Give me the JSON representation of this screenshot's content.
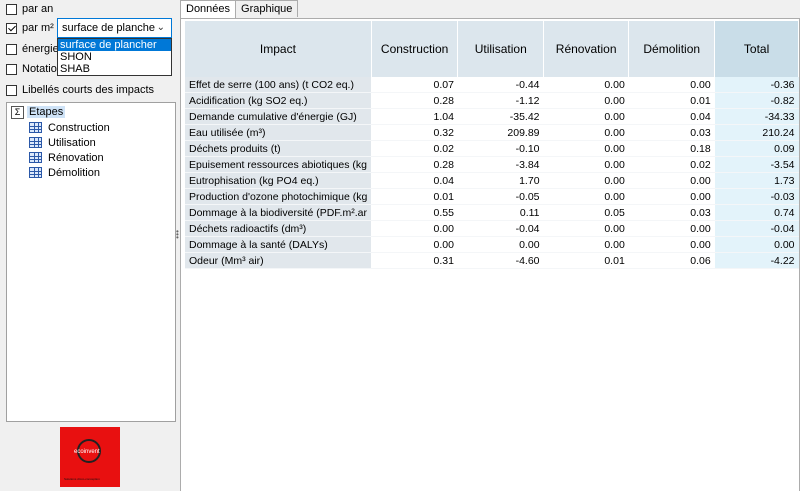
{
  "options": {
    "par_an": {
      "label": "par an",
      "checked": false
    },
    "par_m2": {
      "label": "par m²",
      "checked": true
    },
    "energie": {
      "label": "énergie",
      "checked": false
    },
    "notation": {
      "label": "Notatio",
      "checked": false
    },
    "libelles": {
      "label": "Libellés courts des impacts",
      "checked": false
    }
  },
  "unit_select": {
    "value": "surface de planche",
    "options": [
      "surface de plancher",
      "SHON",
      "SHAB"
    ],
    "highlighted": "surface de plancher"
  },
  "tree": {
    "root": "Etapes",
    "items": [
      "Construction",
      "Utilisation",
      "Rénovation",
      "Démolition"
    ]
  },
  "logo": {
    "text": "ecoinvent",
    "subtitle": "Solutions d'éco-conception"
  },
  "tabs": [
    "Données",
    "Graphique"
  ],
  "table": {
    "headers": [
      "Impact",
      "Construction",
      "Utilisation",
      "Rénovation",
      "Démolition",
      "Total"
    ],
    "rows": [
      [
        "Effet de serre (100 ans) (t CO2 eq.)",
        "0.07",
        "-0.44",
        "0.00",
        "0.00",
        "-0.36"
      ],
      [
        "Acidification (kg SO2 eq.)",
        "0.28",
        "-1.12",
        "0.00",
        "0.01",
        "-0.82"
      ],
      [
        "Demande cumulative d'énergie (GJ)",
        "1.04",
        "-35.42",
        "0.00",
        "0.04",
        "-34.33"
      ],
      [
        "Eau utilisée (m³)",
        "0.32",
        "209.89",
        "0.00",
        "0.03",
        "210.24"
      ],
      [
        "Déchets produits (t)",
        "0.02",
        "-0.10",
        "0.00",
        "0.18",
        "0.09"
      ],
      [
        "Epuisement ressources abiotiques (kg",
        "0.28",
        "-3.84",
        "0.00",
        "0.02",
        "-3.54"
      ],
      [
        "Eutrophisation (kg PO4 eq.)",
        "0.04",
        "1.70",
        "0.00",
        "0.00",
        "1.73"
      ],
      [
        "Production d'ozone photochimique (kg",
        "0.01",
        "-0.05",
        "0.00",
        "0.00",
        "-0.03"
      ],
      [
        "Dommage à la biodiversité (PDF.m².ar",
        "0.55",
        "0.11",
        "0.05",
        "0.03",
        "0.74"
      ],
      [
        "Déchets radioactifs (dm³)",
        "0.00",
        "-0.04",
        "0.00",
        "0.00",
        "-0.04"
      ],
      [
        "Dommage à la santé (DALYs)",
        "0.00",
        "0.00",
        "0.00",
        "0.00",
        "0.00"
      ],
      [
        "Odeur (Mm³ air)",
        "0.31",
        "-4.60",
        "0.01",
        "0.06",
        "-4.22"
      ]
    ]
  }
}
